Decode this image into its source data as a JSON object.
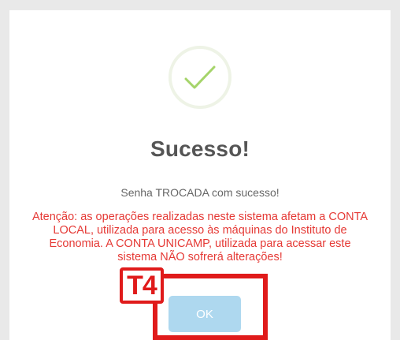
{
  "dialog": {
    "title": "Sucesso!",
    "message": "Senha TROCADA com sucesso!",
    "warning": "Atenção: as operações realizadas neste sistema afetam a CONTA LOCAL, utilizada para acesso às máquinas do Instituto de Economia. A CONTA UNICAMP, utilizada para acessar este sistema NÃO sofrerá alterações!",
    "ok_label": "OK",
    "icon": "checkmark-icon"
  },
  "annotation": {
    "tag": "T4"
  },
  "colors": {
    "checkmark": "#a5d46a",
    "ring": "#eef3e6",
    "title": "#555555",
    "warning": "#e53935",
    "ok_button": "#aed8ef",
    "annotation": "#e01b1b"
  }
}
